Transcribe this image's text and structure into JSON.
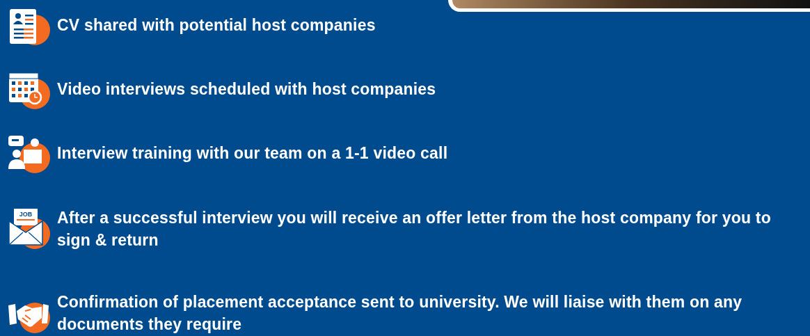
{
  "steps": [
    {
      "kind": "cv",
      "text": "CV shared with potential host companies"
    },
    {
      "kind": "calendar",
      "text": "Video interviews scheduled with host companies"
    },
    {
      "kind": "training",
      "text": "Interview training with our team on a 1-1 video call"
    },
    {
      "kind": "job",
      "icon_label": "JOB",
      "text": "After a successful interview you will receive an offer letter from the host company for you to sign & return"
    },
    {
      "kind": "handshake",
      "text": "Confirmation of placement acceptance sent to university. We will liaise with them on any documents they require"
    }
  ]
}
